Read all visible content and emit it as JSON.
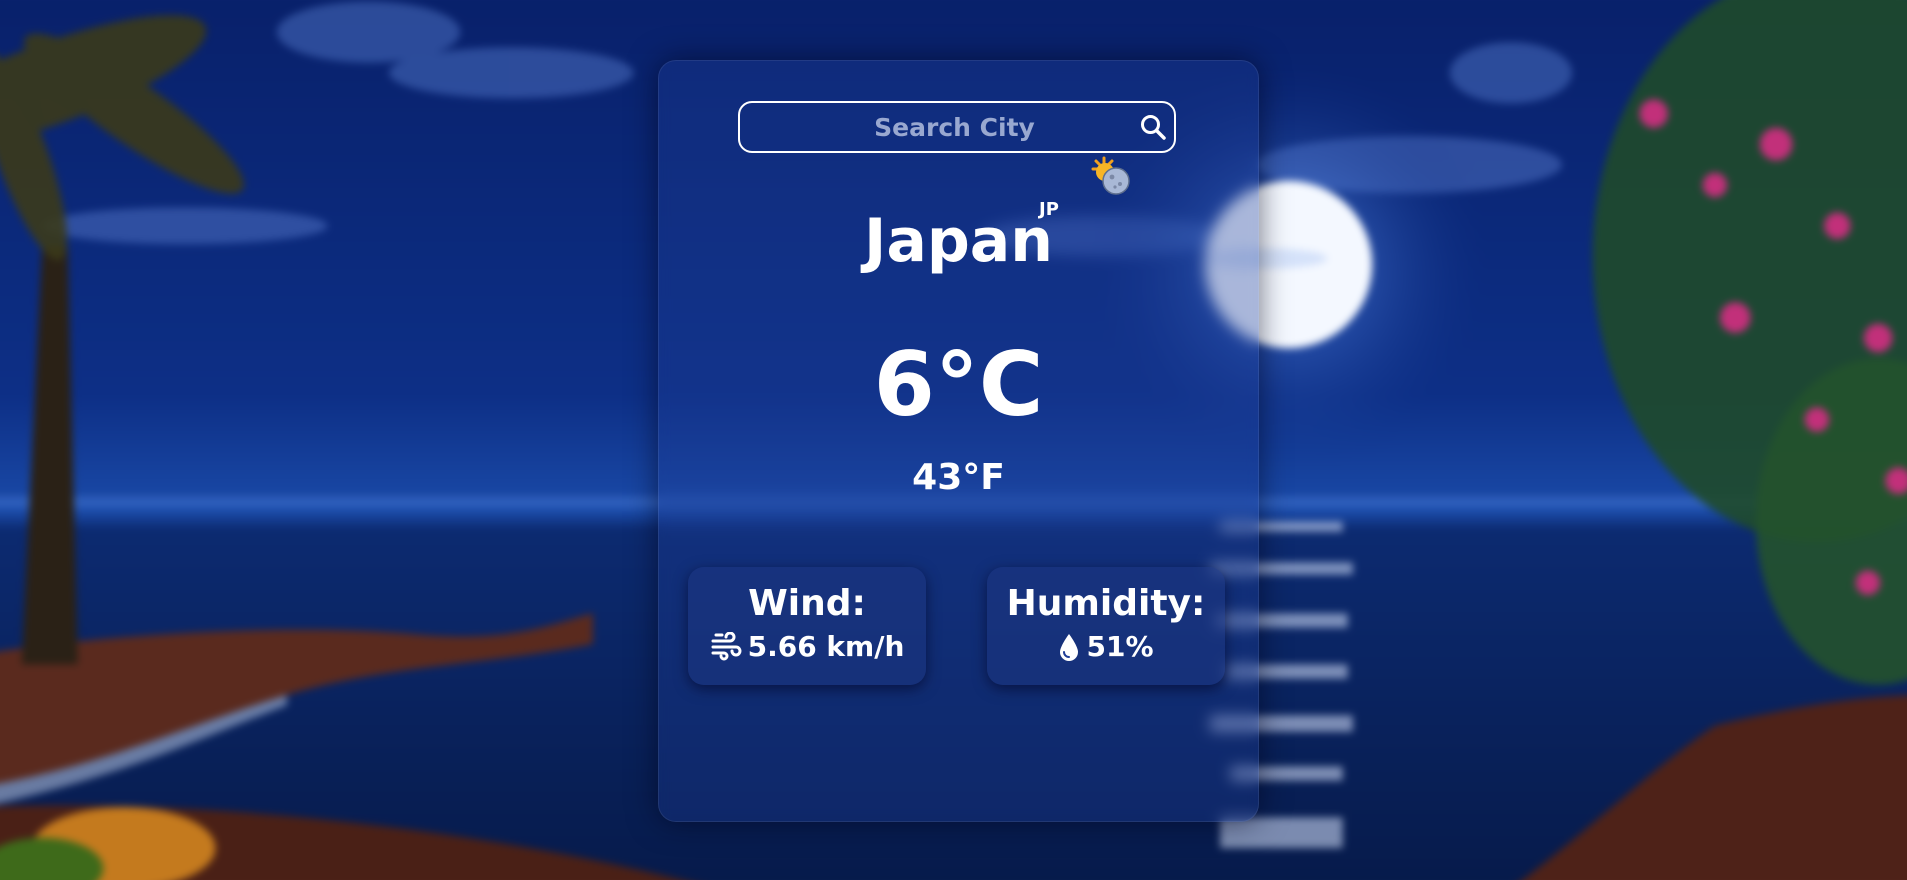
{
  "search": {
    "placeholder": "Search City",
    "value": ""
  },
  "weather": {
    "city": "Japan",
    "country_code": "JP",
    "temp_c": "6°C",
    "temp_f": "43°F",
    "condition_icon": "partly-sunny-icon"
  },
  "stats": {
    "wind": {
      "label": "Wind:",
      "value": "5.66 km/h",
      "icon": "wind-icon"
    },
    "humidity": {
      "label": "Humidity:",
      "value": "51%",
      "icon": "droplet-icon"
    }
  },
  "colors": {
    "night_sky": "#0b2a7a",
    "card_tint": "#1e3c96",
    "moon": "#f4f8ff",
    "text": "#ffffff"
  }
}
